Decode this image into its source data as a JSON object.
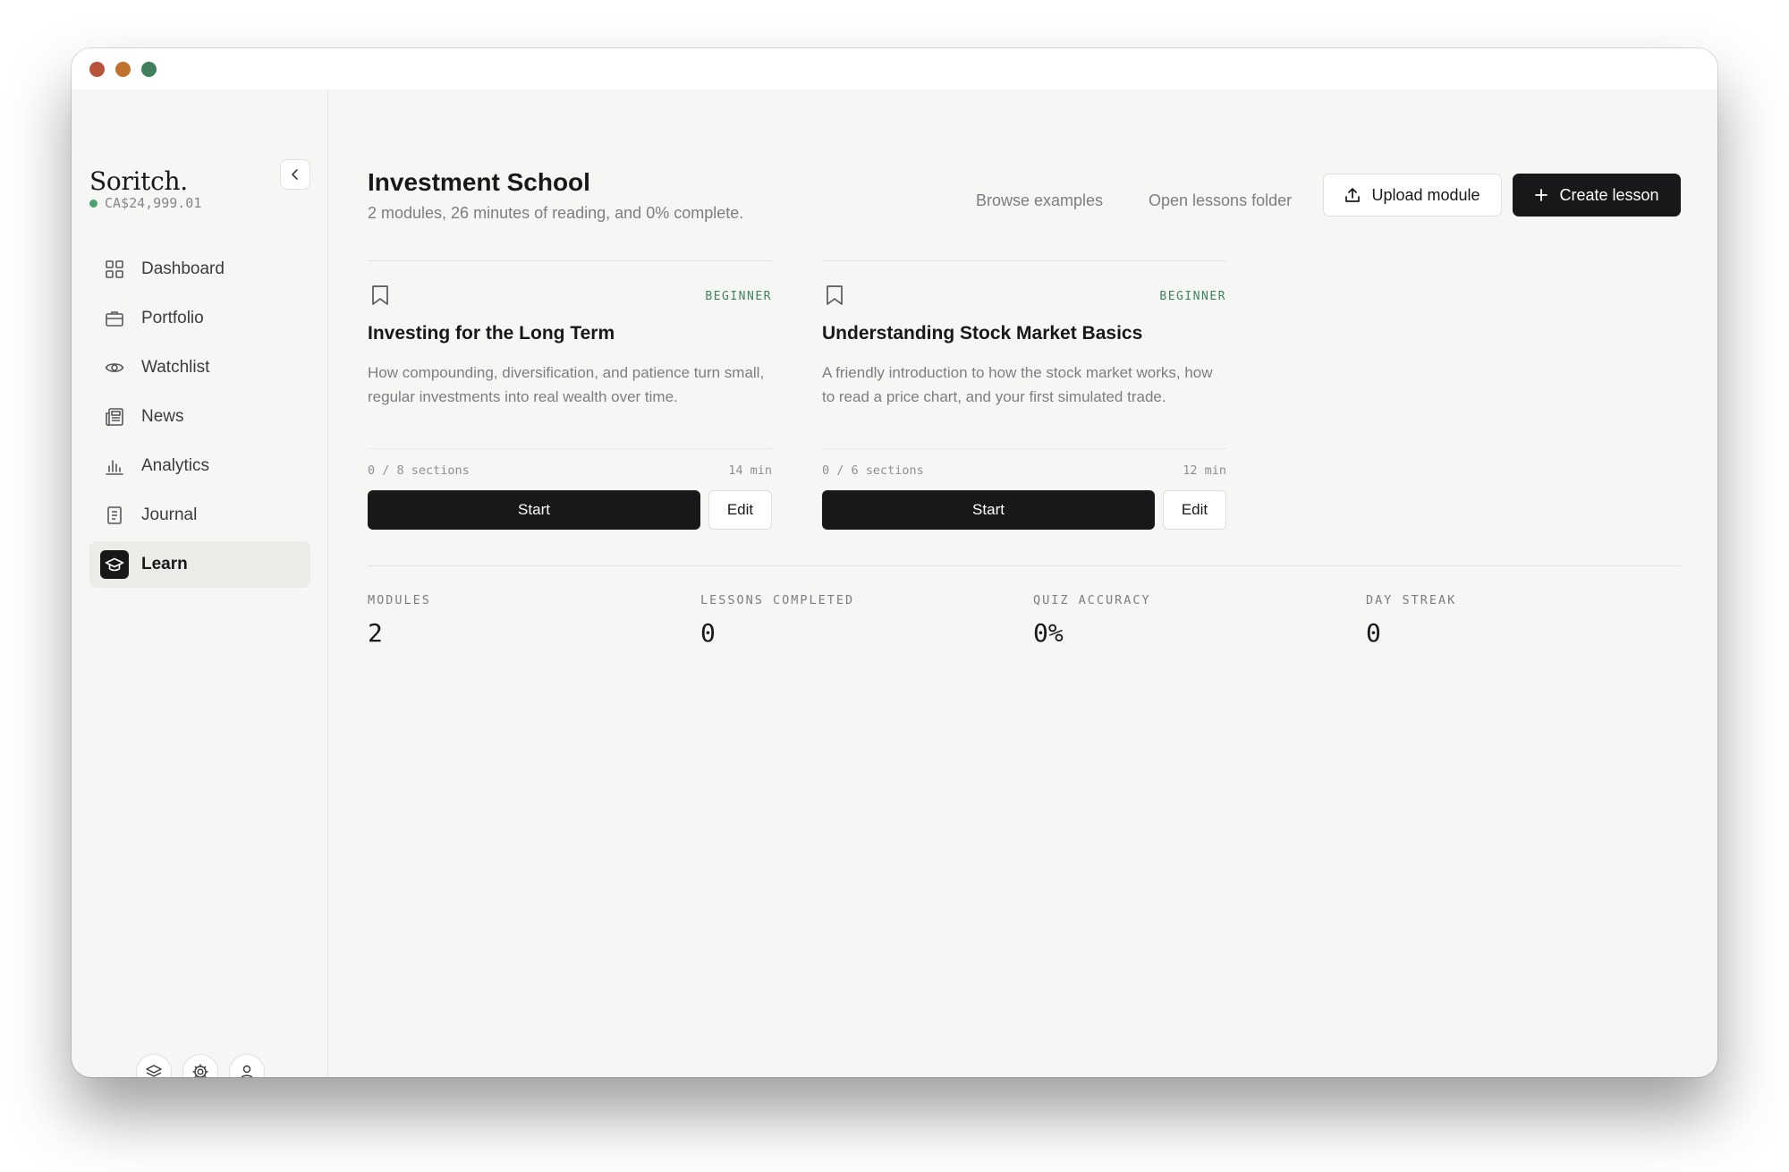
{
  "app": {
    "brand": "Soritch.",
    "balance": "CA$24,999.01"
  },
  "sidebar": {
    "items": [
      {
        "label": "Dashboard",
        "icon": "grid-icon"
      },
      {
        "label": "Portfolio",
        "icon": "briefcase-icon"
      },
      {
        "label": "Watchlist",
        "icon": "eye-icon"
      },
      {
        "label": "News",
        "icon": "newspaper-icon"
      },
      {
        "label": "Analytics",
        "icon": "bar-chart-icon"
      },
      {
        "label": "Journal",
        "icon": "journal-icon"
      },
      {
        "label": "Learn",
        "icon": "graduation-cap-icon",
        "active": true
      }
    ],
    "footer_icons": [
      "layers-icon",
      "settings-icon",
      "user-icon"
    ]
  },
  "header": {
    "title": "Investment School",
    "subtitle": "2 modules, 26 minutes of reading, and 0% complete.",
    "browse_examples": "Browse examples",
    "open_folder": "Open lessons folder",
    "upload_module": "Upload module",
    "create_lesson": "Create lesson"
  },
  "modules": [
    {
      "level": "BEGINNER",
      "title": "Investing for the Long Term",
      "description": "How compounding, diversification, and patience turn small, regular investments into real wealth over time.",
      "sections": "0 / 8 sections",
      "duration": "14 min",
      "start_label": "Start",
      "edit_label": "Edit"
    },
    {
      "level": "BEGINNER",
      "title": "Understanding Stock Market Basics",
      "description": "A friendly introduction to how the stock market works, how to read a price chart, and your first simulated trade.",
      "sections": "0 / 6 sections",
      "duration": "12 min",
      "start_label": "Start",
      "edit_label": "Edit"
    }
  ],
  "stats": [
    {
      "label": "MODULES",
      "value": "2"
    },
    {
      "label": "LESSONS COMPLETED",
      "value": "0"
    },
    {
      "label": "QUIZ ACCURACY",
      "value": "0%"
    },
    {
      "label": "DAY STREAK",
      "value": "0"
    }
  ],
  "colors": {
    "accent_dark": "#16181a",
    "level_green": "#3c8460",
    "status_dot": "#4aa36f",
    "traffic_red": "#b9543c",
    "traffic_yellow": "#c0722e",
    "traffic_green": "#3f7f5c"
  }
}
